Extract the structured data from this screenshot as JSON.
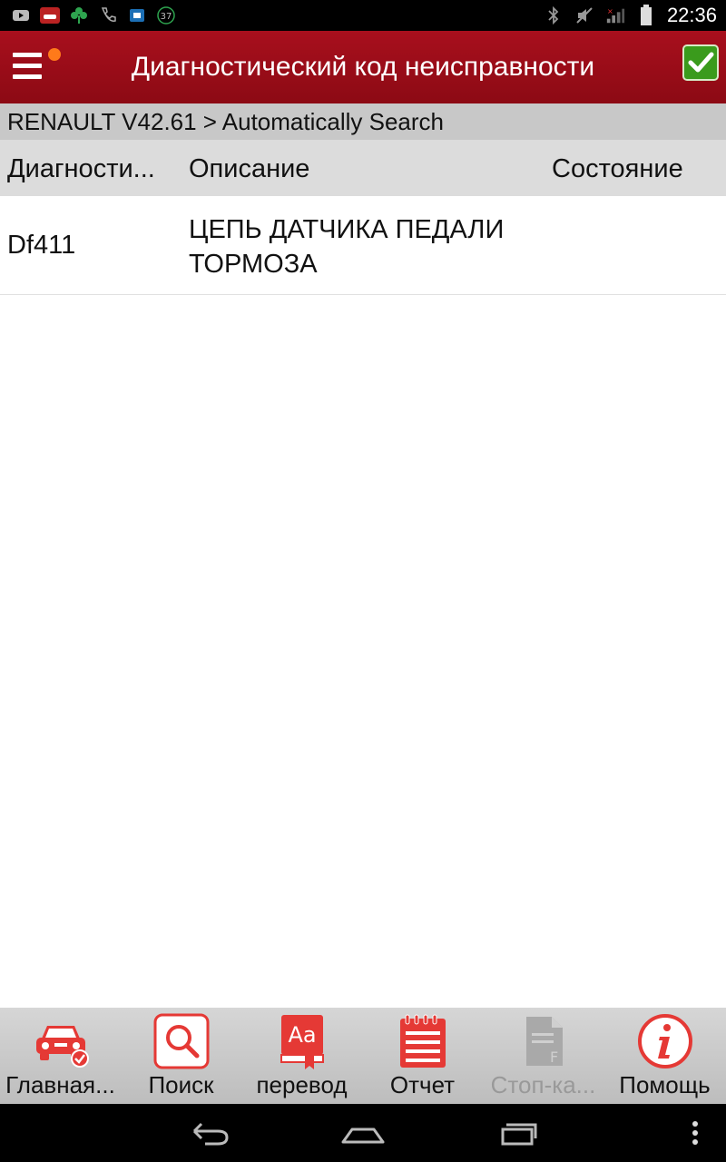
{
  "status_bar": {
    "time": "22:36",
    "notification_badge": "37",
    "icons_left": [
      "youtube-icon",
      "car-app-icon",
      "clover-icon",
      "phone-icon",
      "sim-card-icon",
      "badge-37-icon"
    ],
    "icons_right": [
      "bluetooth-icon",
      "mute-icon",
      "signal-icon",
      "battery-icon"
    ]
  },
  "app_bar": {
    "title": "Диагностический код неисправности",
    "accent_color": "#a80f1d",
    "confirm_color": "#3a9b1c"
  },
  "breadcrumb": "RENAULT V42.61 > Automatically Search",
  "table": {
    "columns": [
      "Диагности...",
      "Описание",
      "Состояние"
    ],
    "rows": [
      {
        "code": "Df411",
        "description": "ЦЕПЬ ДАТЧИКА ПЕДАЛИ ТОРМОЗА",
        "status": ""
      }
    ]
  },
  "toolbar": {
    "items": [
      {
        "label": "Главная...",
        "icon": "car-check-icon",
        "enabled": true
      },
      {
        "label": "Поиск",
        "icon": "search-icon",
        "enabled": true
      },
      {
        "label": "перевод",
        "icon": "translate-book-icon",
        "enabled": true
      },
      {
        "label": "Отчет",
        "icon": "report-notepad-icon",
        "enabled": true
      },
      {
        "label": "Стоп-ка...",
        "icon": "freeze-frame-icon",
        "enabled": false
      },
      {
        "label": "Помощь",
        "icon": "info-icon",
        "enabled": true
      }
    ]
  },
  "nav_bar": [
    "back-icon",
    "home-icon",
    "recents-icon",
    "overflow-menu-icon"
  ]
}
